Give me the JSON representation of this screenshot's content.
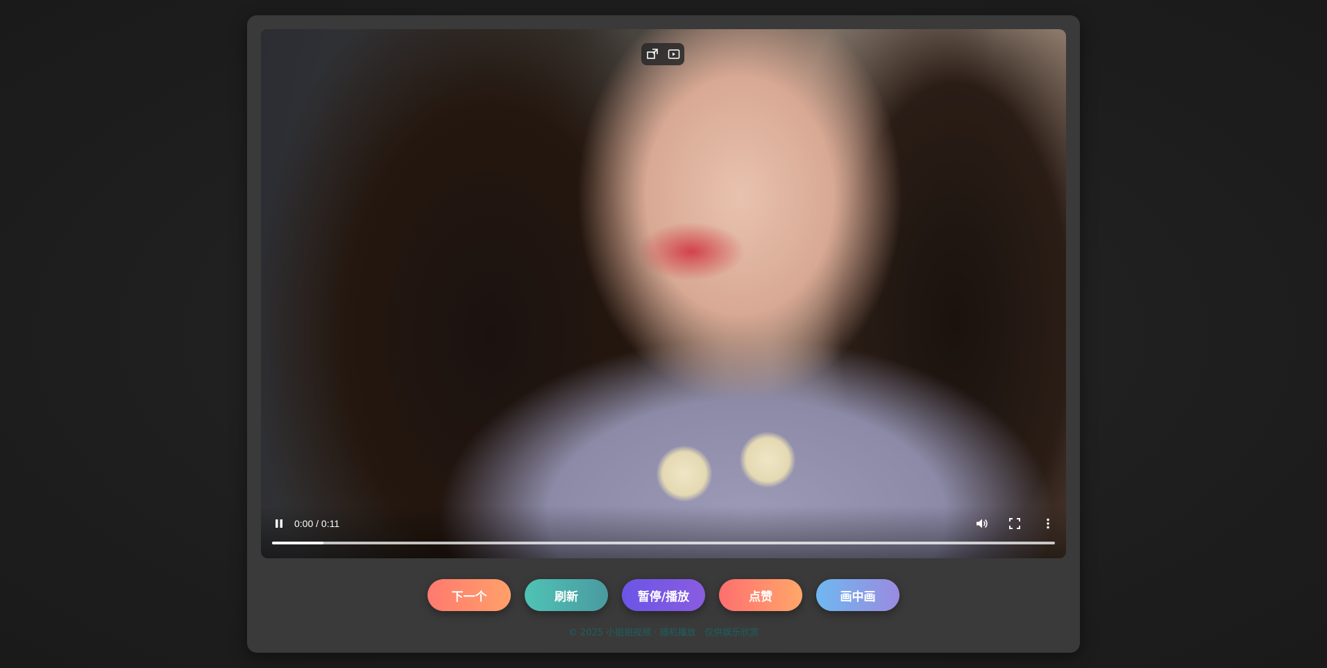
{
  "player": {
    "time_display": "0:00 / 0:11",
    "progress": 0.066
  },
  "buttons": [
    {
      "label": "下一个",
      "colors": [
        "#ff7a6e",
        "#ffa06a"
      ]
    },
    {
      "label": "刷新",
      "colors": [
        "#4fc3b5",
        "#4a9aa0"
      ]
    },
    {
      "label": "暂停/播放",
      "colors": [
        "#6b55e6",
        "#8a5ce0"
      ]
    },
    {
      "label": "点赞",
      "colors": [
        "#ff6f6f",
        "#ffa76a"
      ]
    },
    {
      "label": "画中画",
      "colors": [
        "#6fb8f0",
        "#9a8ae0"
      ]
    }
  ],
  "footer": {
    "text": "© 2025 小姐姐视频 · 随机播放 · 仅供娱乐欣赏"
  },
  "icons": {
    "pip_toolbar": [
      "pip-exit-icon",
      "pip-play-icon"
    ],
    "controls": [
      "pause-icon",
      "volume-icon",
      "fullscreen-icon",
      "more-vert-icon"
    ]
  }
}
